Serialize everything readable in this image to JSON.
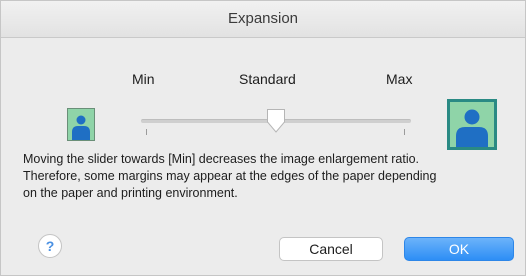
{
  "window": {
    "title": "Expansion"
  },
  "slider": {
    "labels": {
      "min": "Min",
      "standard": "Standard",
      "max": "Max"
    },
    "position": 0.5
  },
  "description": {
    "lines": [
      "Moving the slider towards [Min] decreases the image enlargement ratio.",
      "Therefore, some margins may appear at the edges of the paper depending",
      "on the paper and printing environment."
    ]
  },
  "buttons": {
    "help": "?",
    "cancel": "Cancel",
    "ok": "OK"
  },
  "colors": {
    "accent": "#2d8ef5",
    "preview_background": "#8fd4a8",
    "person_figure": "#1f6fc4",
    "selected_frame": "#2a8a84"
  },
  "icons": {
    "min_preview": "person-small-icon",
    "max_preview": "person-large-icon"
  }
}
